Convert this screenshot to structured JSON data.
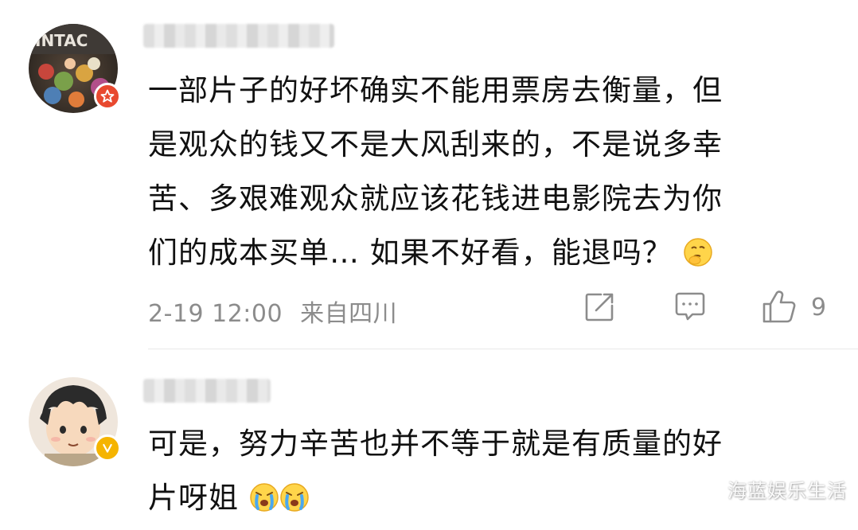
{
  "comments": [
    {
      "text_lines": [
        "一部片子的好坏确实不能用票房去衡量，但",
        "是观众的钱又不是大风刮来的，不是说多幸",
        "苦、多艰难观众就应该花钱进电影院去为你",
        "们的成本买单… 如果不好看，能退吗？"
      ],
      "emoji": "thinking-emoji",
      "timestamp": "2-19 12:00",
      "location": "来自四川",
      "like_count": "9",
      "badge": "star-badge",
      "badge_color": "#e8492f"
    },
    {
      "text_lines": [
        "可是，努力辛苦也并不等于就是有质量的好",
        "片呀姐"
      ],
      "emoji": "crying-emoji",
      "badge": "verified-v-badge",
      "badge_color": "#f5b400"
    }
  ],
  "watermark": "海蓝娱乐生活",
  "colors": {
    "text": "#111111",
    "meta": "#8c8c8c",
    "divider": "#e8e8e8"
  }
}
